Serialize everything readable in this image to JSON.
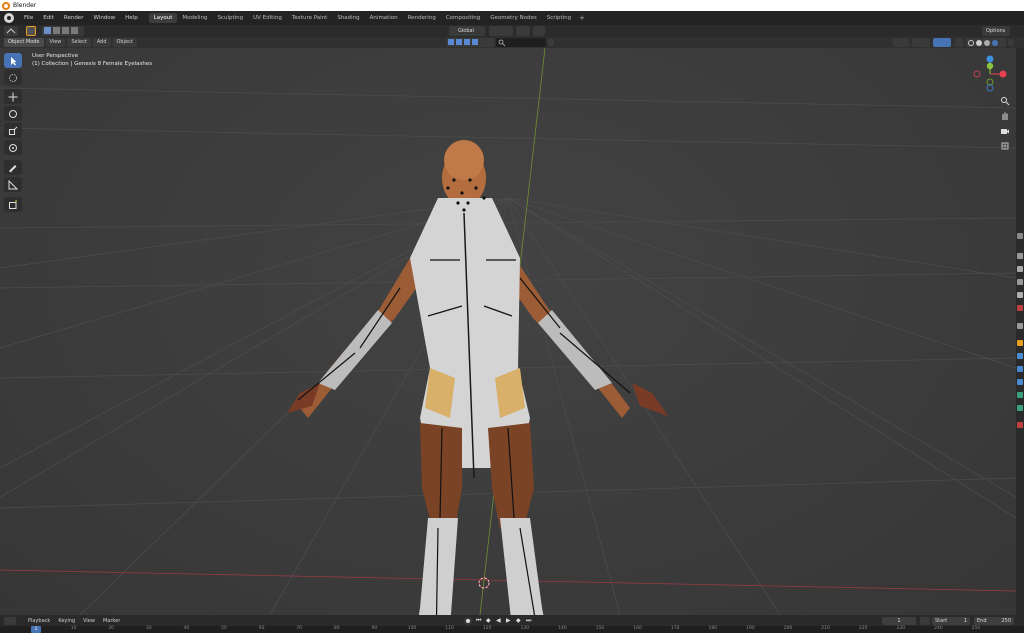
{
  "window": {
    "title": "Blender"
  },
  "menu": [
    "File",
    "Edit",
    "Render",
    "Window",
    "Help"
  ],
  "workspaces": [
    "Layout",
    "Modeling",
    "Sculpting",
    "UV Editing",
    "Texture Paint",
    "Shading",
    "Animation",
    "Rendering",
    "Compositing",
    "Geometry Nodes",
    "Scripting"
  ],
  "active_workspace": "Layout",
  "tool_header": {
    "orientation": "Global",
    "options_label": "Options"
  },
  "mode_header": {
    "mode": "Object Mode",
    "menus": [
      "View",
      "Select",
      "Add",
      "Object"
    ]
  },
  "viewport": {
    "perspective_label": "User Perspective",
    "collection_label": "(1) Collection | Genesis 8 Female Eyelashes"
  },
  "left_tools": [
    "cursor-select",
    "cursor-3d",
    "move",
    "rotate",
    "scale",
    "transform",
    "annotate",
    "measure",
    "add-cube"
  ],
  "gizmo": {
    "axes": [
      "X",
      "Y",
      "Z"
    ],
    "colors": {
      "x": "#e84050",
      "y": "#8bc53f",
      "z": "#3d8fe0"
    }
  },
  "timeline": {
    "menus": [
      "Playback",
      "Keying",
      "View",
      "Marker"
    ],
    "current_frame": "1",
    "start_label": "Start",
    "start": "1",
    "end_label": "End",
    "end": "250",
    "ruler_ticks": [
      "1",
      "10",
      "20",
      "30",
      "40",
      "50",
      "60",
      "70",
      "80",
      "90",
      "100",
      "110",
      "120",
      "130",
      "140",
      "150",
      "160",
      "170",
      "180",
      "190",
      "200",
      "210",
      "220",
      "230",
      "240",
      "250"
    ],
    "active_frame": "1"
  },
  "colors": {
    "accent": "#4772b3",
    "header": "#2b2b2b",
    "viewport": "#3d3d3d"
  }
}
